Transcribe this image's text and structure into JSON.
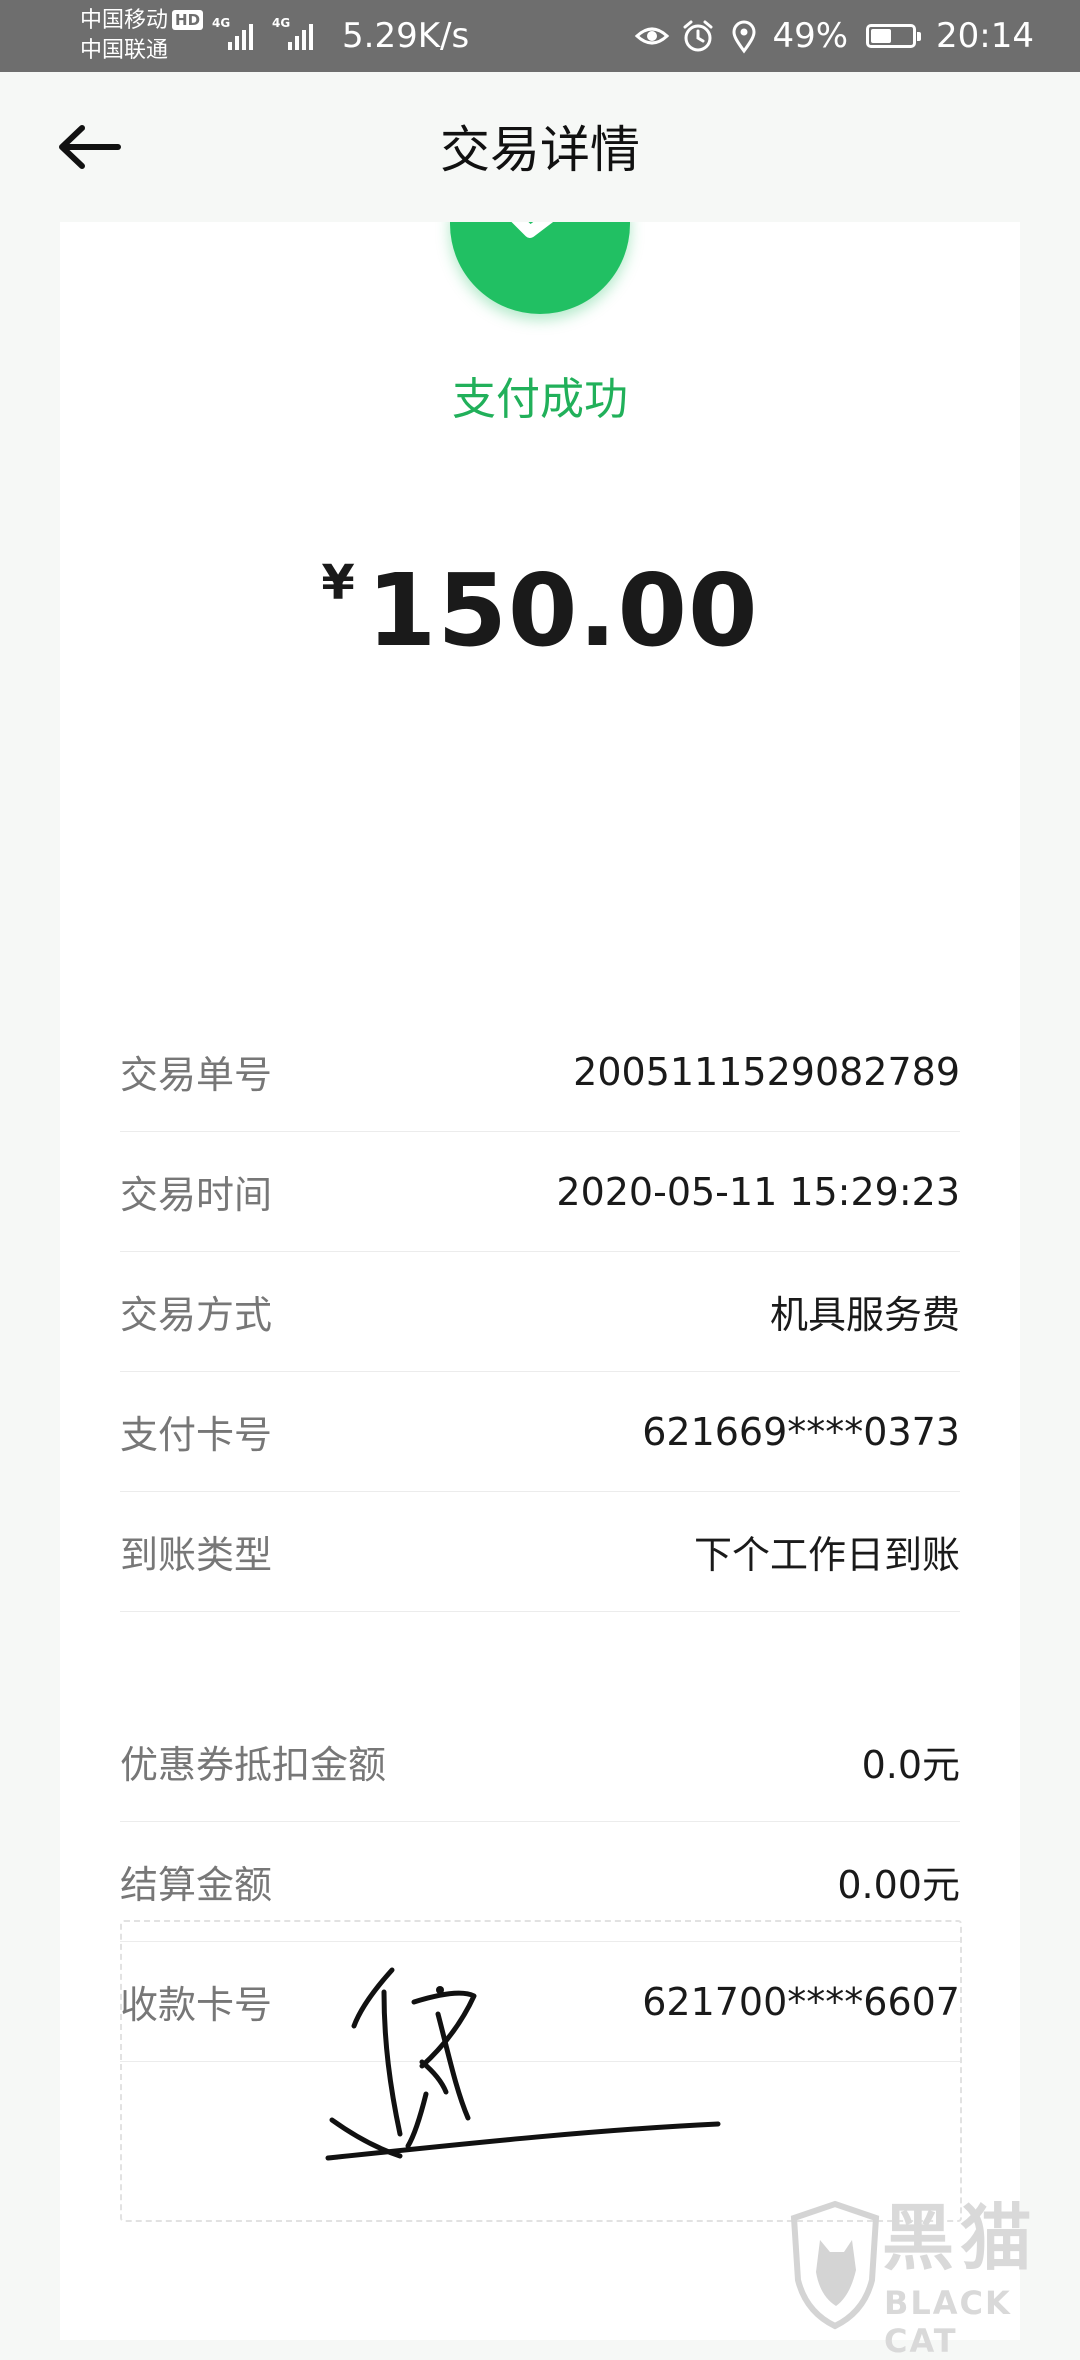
{
  "status_bar": {
    "carrier1": "中国移动",
    "hd_badge": "HD",
    "carrier2": "中国联通",
    "network1": "4G",
    "network2": "4G",
    "net_speed": "5.29K/s",
    "battery_percent": "49%",
    "battery_level": 0.49,
    "time": "20:14",
    "icons": [
      "eye-icon",
      "alarm-icon",
      "location-icon",
      "battery-icon"
    ]
  },
  "header": {
    "title": "交易详情",
    "back_icon": "arrow-left-icon"
  },
  "result": {
    "icon": "check-circle-icon",
    "status_text": "支付成功",
    "currency_symbol": "¥",
    "amount": "150.00",
    "accent_color": "#21c063"
  },
  "details": [
    {
      "label": "交易单号",
      "value": "2005111529082789"
    },
    {
      "label": "交易时间",
      "value": "2020-05-11 15:29:23"
    },
    {
      "label": "交易方式",
      "value": "机具服务费"
    },
    {
      "label": "支付卡号",
      "value": "621669****0373"
    },
    {
      "label": "到账类型",
      "value": "下个工作日到账"
    }
  ],
  "settlement": [
    {
      "label": "优惠券抵扣金额",
      "value": "0.0元"
    },
    {
      "label": "结算金额",
      "value": "0.00元"
    },
    {
      "label": "收款卡号",
      "value": "621700****6607"
    }
  ],
  "watermark": {
    "text": "黑猫",
    "sub": "BLACK CAT"
  }
}
